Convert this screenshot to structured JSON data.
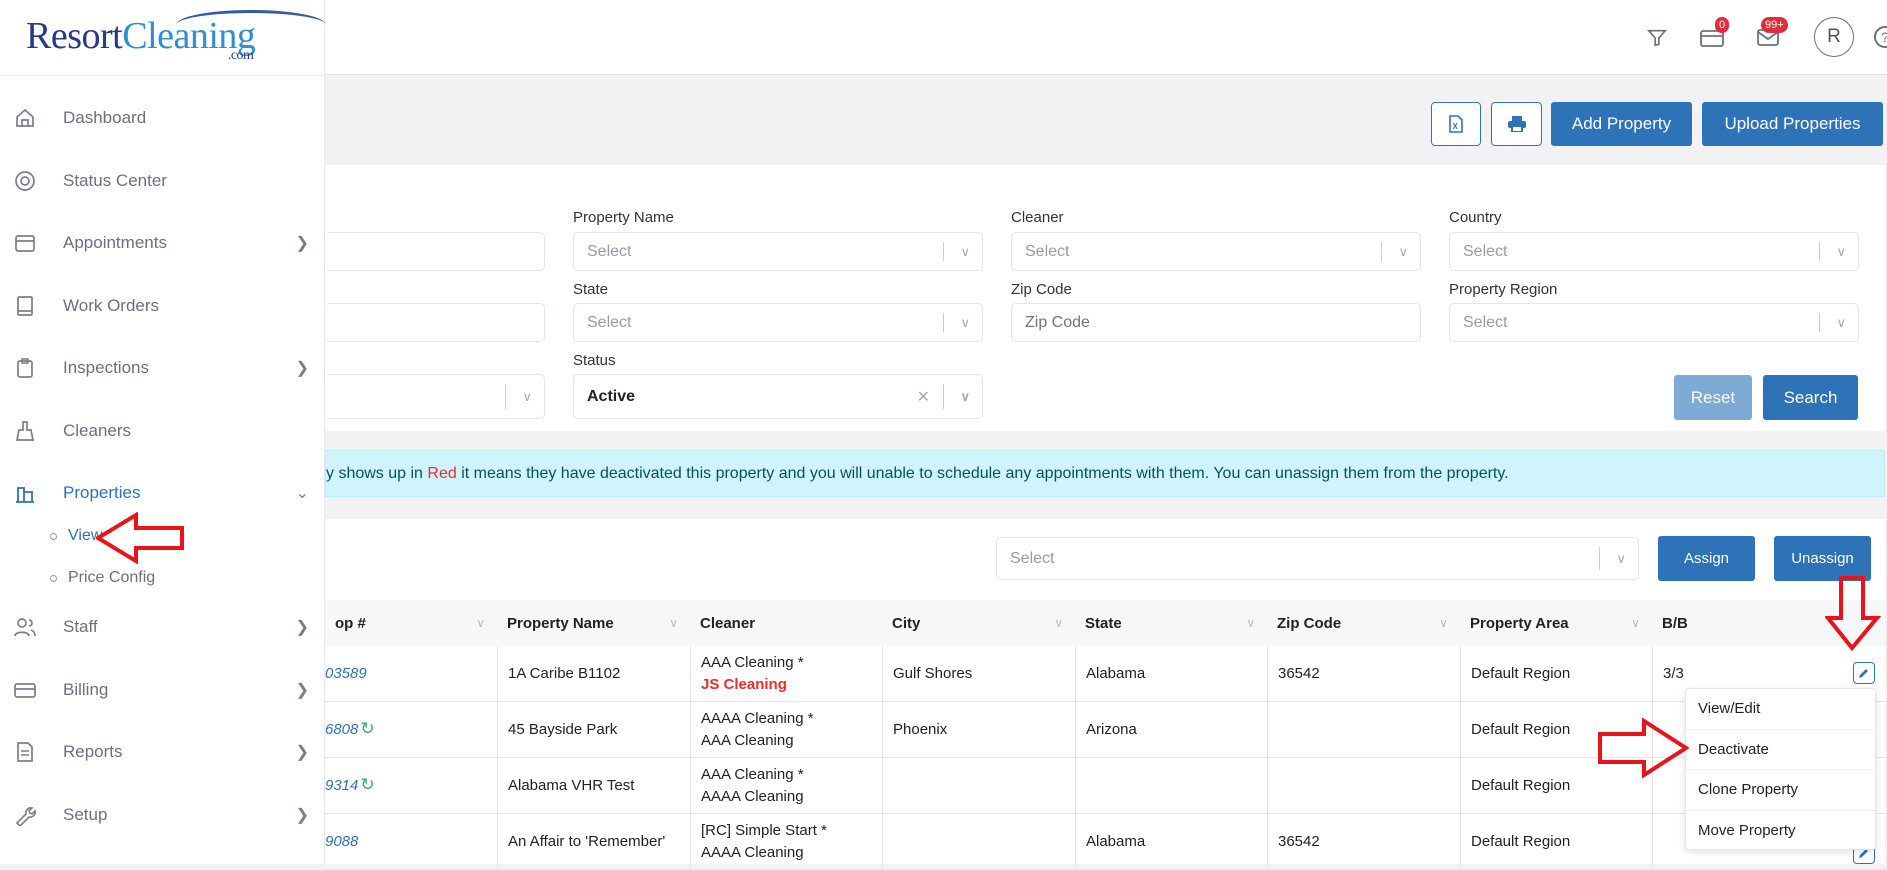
{
  "logo": {
    "part1": "Resort",
    "part2": "Cleaning",
    "suffix": ".com"
  },
  "header": {
    "notifications_badge": "0",
    "messages_badge": "99+",
    "avatar_initial": "R"
  },
  "sidebar": {
    "items": [
      {
        "label": "Dashboard",
        "icon": "home-icon"
      },
      {
        "label": "Status Center",
        "icon": "lifebuoy-icon"
      },
      {
        "label": "Appointments",
        "icon": "calendar-icon",
        "chevron": true
      },
      {
        "label": "Work Orders",
        "icon": "book-icon"
      },
      {
        "label": "Inspections",
        "icon": "clipboard-icon",
        "chevron": true
      },
      {
        "label": "Cleaners",
        "icon": "broom-icon"
      },
      {
        "label": "Properties",
        "icon": "building-icon",
        "expanded": true
      },
      {
        "label": "Staff",
        "icon": "users-icon",
        "chevron": true
      },
      {
        "label": "Billing",
        "icon": "credit-card-icon",
        "chevron": true
      },
      {
        "label": "Reports",
        "icon": "document-icon",
        "chevron": true
      },
      {
        "label": "Setup",
        "icon": "wrench-icon",
        "chevron": true
      }
    ],
    "sub_items": [
      {
        "label": "View",
        "active": true
      },
      {
        "label": "Price Config"
      }
    ]
  },
  "toolbar": {
    "add_property": "Add Property",
    "upload_properties": "Upload Properties"
  },
  "filters": {
    "property_name": {
      "label": "Property Name",
      "placeholder": "Select"
    },
    "cleaner": {
      "label": "Cleaner",
      "placeholder": "Select"
    },
    "country": {
      "label": "Country",
      "placeholder": "Select"
    },
    "state": {
      "label": "State",
      "placeholder": "Select"
    },
    "zip_code": {
      "label": "Zip Code",
      "placeholder": "Zip Code"
    },
    "property_region": {
      "label": "Property Region",
      "placeholder": "Select"
    },
    "status": {
      "label": "Status",
      "value": "Active"
    },
    "reset": "Reset",
    "search": "Search"
  },
  "alert": {
    "before": "y shows up in ",
    "red": "Red",
    "after": " it means they have deactivated this property and you will unable to schedule any appointments with them. You can unassign them from the property."
  },
  "bulk": {
    "placeholder": "Select",
    "assign": "Assign",
    "unassign": "Unassign"
  },
  "table": {
    "columns": [
      "op #",
      "Property Name",
      "Cleaner",
      "City",
      "State",
      "Zip Code",
      "Property Area",
      "B/B"
    ],
    "rows": [
      {
        "prop": "03589",
        "sync": false,
        "name": "1A Caribe B1102",
        "cleaner1": "AAA Cleaning *",
        "cleaner2": "JS Cleaning",
        "cleaner2_red": true,
        "city": "Gulf Shores",
        "state": "Alabama",
        "zip": "36542",
        "area": "Default Region",
        "bb": "3/3"
      },
      {
        "prop": "6808",
        "sync": true,
        "name": "45 Bayside Park",
        "cleaner1": "AAAA Cleaning *",
        "cleaner2": "AAA Cleaning",
        "city": "Phoenix",
        "state": "Arizona",
        "zip": "",
        "area": "Default Region",
        "bb": ""
      },
      {
        "prop": "9314",
        "sync": true,
        "name": "Alabama VHR Test",
        "cleaner1": "AAA Cleaning *",
        "cleaner2": "AAAA Cleaning",
        "city": "",
        "state": "",
        "zip": "",
        "area": "Default Region",
        "bb": ""
      },
      {
        "prop": "9088",
        "sync": false,
        "name": "An Affair to 'Remember'",
        "cleaner1": "[RC] Simple Start *",
        "cleaner2": "AAAA Cleaning",
        "city": "",
        "state": "Alabama",
        "zip": "36542",
        "area": "Default Region",
        "bb": ""
      }
    ]
  },
  "row_menu": [
    "View/Edit",
    "Deactivate",
    "Clone Property",
    "Move Property"
  ],
  "colors": {
    "primary": "#2e72b8",
    "danger": "#e8302a",
    "alert_bg": "#cff4fc",
    "annotation_arrow": "#e8141c"
  }
}
